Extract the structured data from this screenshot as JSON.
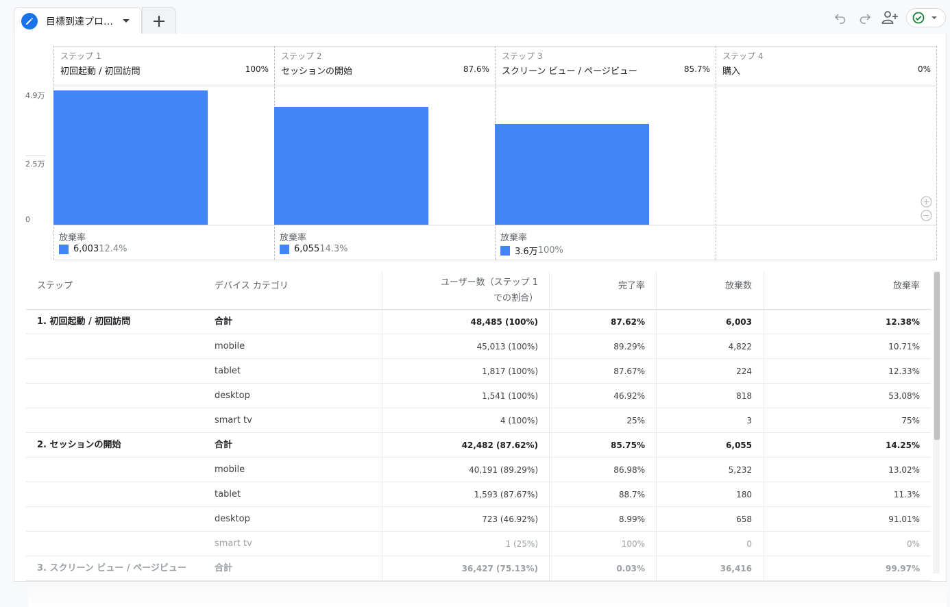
{
  "tab": {
    "title": "目標到達プロ…"
  },
  "toolbar": {
    "undo_icon": "undo-icon",
    "redo_icon": "redo-icon",
    "share_icon": "person-add-icon",
    "status_icon": "check-circle-icon",
    "add_icon": "plus-icon"
  },
  "colors": {
    "bar": "#4285f4",
    "accent": "#1a73e8",
    "status": "#188038"
  },
  "funnel": {
    "y_ticks": [
      "4.9万",
      "2.5万",
      "0"
    ],
    "steps": [
      {
        "num": "ステップ 1",
        "name": "初回起動 / 初回訪問",
        "pct": "100%",
        "abandon_label": "放棄率",
        "abandon_count": "6,003",
        "abandon_rate": "12.4%"
      },
      {
        "num": "ステップ 2",
        "name": "セッションの開始",
        "pct": "87.6%",
        "abandon_label": "放棄率",
        "abandon_count": "6,055",
        "abandon_rate": "14.3%"
      },
      {
        "num": "ステップ 3",
        "name": "スクリーン ビュー / ページビュー",
        "pct": "85.7%",
        "abandon_label": "放棄率",
        "abandon_count": "3.6万",
        "abandon_rate": "100%"
      },
      {
        "num": "ステップ 4",
        "name": "購入",
        "pct": "0%",
        "abandon_label": "",
        "abandon_count": "",
        "abandon_rate": ""
      }
    ]
  },
  "chart_data": {
    "type": "bar",
    "categories": [
      "初回起動 / 初回訪問",
      "セッションの開始",
      "スクリーン ビュー / ページビュー",
      "購入"
    ],
    "values": [
      48485,
      42482,
      36427,
      0
    ],
    "ylim": [
      0,
      49000
    ],
    "y_tick_labels": [
      "0",
      "2.5万",
      "4.9万"
    ]
  },
  "table": {
    "headers": {
      "step": "ステップ",
      "device": "デバイス カテゴリ",
      "users_l1": "ユーザー数（ステップ 1",
      "users_l2": "での割合）",
      "completion": "完了率",
      "abandons": "放棄数",
      "abandon_rate": "放棄率"
    },
    "rows": [
      {
        "step": "1. 初回起動 / 初回訪問",
        "device": "合計",
        "users": "48,485 (100%)",
        "completion": "87.62%",
        "abandons": "6,003",
        "rate": "12.38%"
      },
      {
        "step": "",
        "device": "mobile",
        "users": "45,013 (100%)",
        "completion": "89.29%",
        "abandons": "4,822",
        "rate": "10.71%"
      },
      {
        "step": "",
        "device": "tablet",
        "users": "1,817 (100%)",
        "completion": "87.67%",
        "abandons": "224",
        "rate": "12.33%"
      },
      {
        "step": "",
        "device": "desktop",
        "users": "1,541 (100%)",
        "completion": "46.92%",
        "abandons": "818",
        "rate": "53.08%"
      },
      {
        "step": "",
        "device": "smart tv",
        "users": "4 (100%)",
        "completion": "25%",
        "abandons": "3",
        "rate": "75%"
      },
      {
        "step": "2. セッションの開始",
        "device": "合計",
        "users": "42,482 (87.62%)",
        "completion": "85.75%",
        "abandons": "6,055",
        "rate": "14.25%"
      },
      {
        "step": "",
        "device": "mobile",
        "users": "40,191 (89.29%)",
        "completion": "86.98%",
        "abandons": "5,232",
        "rate": "13.02%"
      },
      {
        "step": "",
        "device": "tablet",
        "users": "1,593 (87.67%)",
        "completion": "88.7%",
        "abandons": "180",
        "rate": "11.3%"
      },
      {
        "step": "",
        "device": "desktop",
        "users": "723 (46.92%)",
        "completion": "8.99%",
        "abandons": "658",
        "rate": "91.01%"
      },
      {
        "step": "",
        "device": "smart tv",
        "users": "1 (25%)",
        "completion": "100%",
        "abandons": "0",
        "rate": "0%"
      },
      {
        "step": "3. スクリーン ビュー / ページビュー",
        "device": "合計",
        "users": "36,427 (75.13%)",
        "completion": "0.03%",
        "abandons": "36,416",
        "rate": "99.97%"
      }
    ]
  }
}
